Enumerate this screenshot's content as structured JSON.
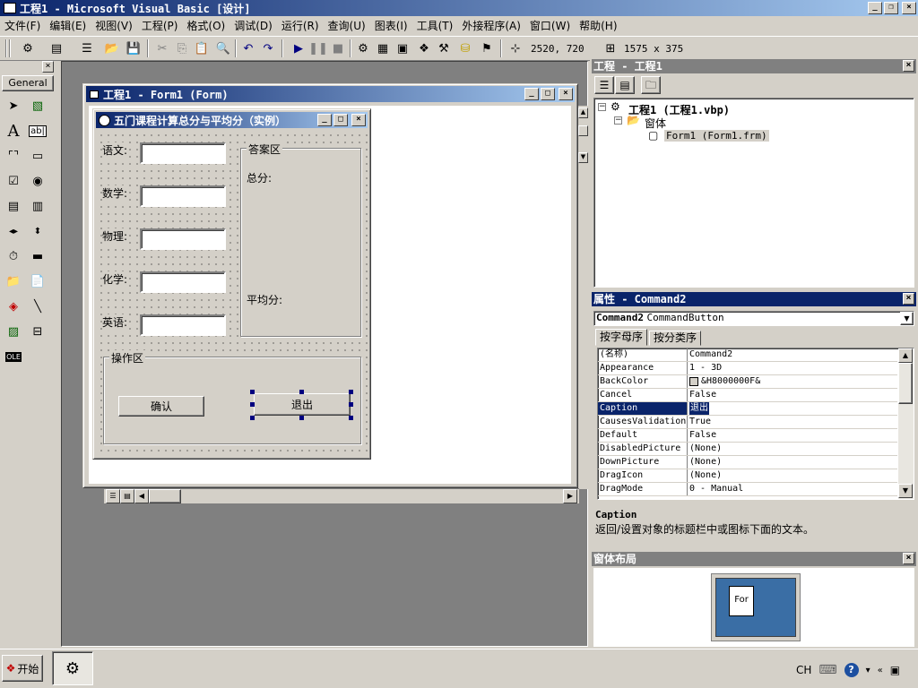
{
  "app": {
    "title": "工程1 - Microsoft Visual Basic [设计]"
  },
  "menu": [
    "文件(F)",
    "编辑(E)",
    "视图(V)",
    "工程(P)",
    "格式(O)",
    "调试(D)",
    "运行(R)",
    "查询(U)",
    "图表(I)",
    "工具(T)",
    "外接程序(A)",
    "窗口(W)",
    "帮助(H)"
  ],
  "toolbar": {
    "position": "2520, 720",
    "size": "1575 x 375"
  },
  "toolbox": {
    "tab": "General"
  },
  "formdesigner": {
    "title": "工程1 - Form1 (Form)"
  },
  "form": {
    "title": "五门课程计算总分与平均分（实例）",
    "labels": [
      "语文:",
      "数学:",
      "物理:",
      "化学:",
      "英语:"
    ],
    "answer_frame": "答案区",
    "total_label": "总分:",
    "avg_label": "平均分:",
    "op_frame": "操作区",
    "ok_button": "确认",
    "exit_button": "退出"
  },
  "project": {
    "title": "工程 - 工程1",
    "root": "工程1 (工程1.vbp)",
    "folder": "窗体",
    "item": "Form1 (Form1.frm)"
  },
  "properties": {
    "title": "属性 - Command2",
    "object_name": "Command2",
    "object_type": "CommandButton",
    "tab_alpha": "按字母序",
    "tab_cat": "按分类序",
    "rows": [
      {
        "name": "(名称)",
        "value": "Command2"
      },
      {
        "name": "Appearance",
        "value": "1 - 3D"
      },
      {
        "name": "BackColor",
        "value": "&H8000000F&"
      },
      {
        "name": "Cancel",
        "value": "False"
      },
      {
        "name": "Caption",
        "value": "退出"
      },
      {
        "name": "CausesValidation",
        "value": "True"
      },
      {
        "name": "Default",
        "value": "False"
      },
      {
        "name": "DisabledPicture",
        "value": "(None)"
      },
      {
        "name": "DownPicture",
        "value": "(None)"
      },
      {
        "name": "DragIcon",
        "value": "(None)"
      },
      {
        "name": "DragMode",
        "value": "0 - Manual"
      }
    ],
    "desc_title": "Caption",
    "desc_text": "返回/设置对象的标题栏中或图标下面的文本。"
  },
  "layout": {
    "title": "窗体布局",
    "form_label": "For"
  },
  "taskbar": {
    "start": "开始",
    "lang": "CH"
  }
}
